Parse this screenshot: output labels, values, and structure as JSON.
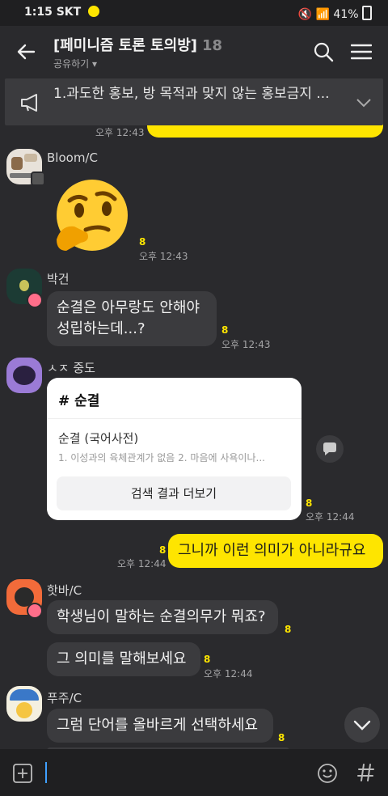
{
  "status_bar": {
    "time": "1:15",
    "carrier": "SKT",
    "battery": "41%"
  },
  "header": {
    "title": "[페미니즘 토론 토의방]",
    "member_count": "18",
    "share_label": "공유하기"
  },
  "notice": {
    "text": "1.과도한 홍보, 방 목적과 맞지 않는 홍보금지 ..."
  },
  "messages": {
    "top_time": "오후 12:43",
    "bloom": {
      "name": "Bloom/C",
      "unread": "8",
      "time": "오후 12:43"
    },
    "park": {
      "name": "박건",
      "text": "순결은 아무랑도 안해야 성립하는데...?",
      "unread": "8",
      "time": "오후 12:43"
    },
    "sj": {
      "name": "ㅅㅈ 중도",
      "card_title": "# 순결",
      "card_heading": "순결 (국어사전)",
      "card_snippet": "1. 이성과의 육체관계가 없음 2. 마음에 사욕이나...",
      "card_button": "검색 결과 더보기",
      "unread": "8",
      "time": "오후 12:44"
    },
    "me": {
      "text": "그니까 이런 의미가 아니라규요",
      "unread": "8",
      "time": "오후 12:44"
    },
    "hotba": {
      "name": "핫바/C",
      "text1": "학생님이 말하는 순결의무가 뭐죠?",
      "unread1": "8",
      "text2": "그 의미를 말해보세요",
      "unread2": "8",
      "time": "오후 12:44"
    },
    "puju": {
      "name": "푸주/C",
      "text": "그럼 단어를 올바르게 선택하세요",
      "unread": "8"
    }
  }
}
